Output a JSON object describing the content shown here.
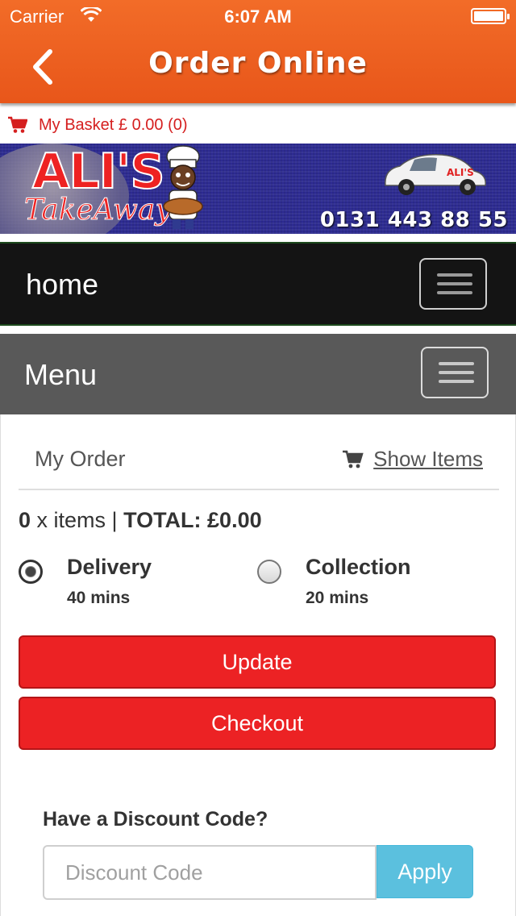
{
  "status_bar": {
    "carrier": "Carrier",
    "time": "6:07 AM"
  },
  "nav": {
    "title": "Order Online"
  },
  "basket": {
    "label": "My Basket £ 0.00 (0)"
  },
  "banner": {
    "brand": "ALI'S",
    "brand_sub": "TakeAway",
    "phone": "0131 443 88 55",
    "car_text": "ALI'S"
  },
  "home_bar": {
    "label": "home"
  },
  "menu_bar": {
    "label": "Menu"
  },
  "order": {
    "title": "My Order",
    "show_items": "Show Items",
    "count": "0",
    "items_text": " x items | ",
    "total_label": "TOTAL: £0.00"
  },
  "delivery": {
    "label": "Delivery",
    "time": "40 mins",
    "selected": true
  },
  "collection": {
    "label": "Collection",
    "time": "20 mins",
    "selected": false
  },
  "buttons": {
    "update": "Update",
    "checkout": "Checkout"
  },
  "discount": {
    "title": "Have a Discount Code?",
    "placeholder": "Discount Code",
    "apply": "Apply"
  },
  "colors": {
    "nav": "#f26c28",
    "banner": "#2d2b92",
    "primary_button": "#ec2224",
    "apply_button": "#5bc0de",
    "basket_text": "#d51f1f"
  }
}
